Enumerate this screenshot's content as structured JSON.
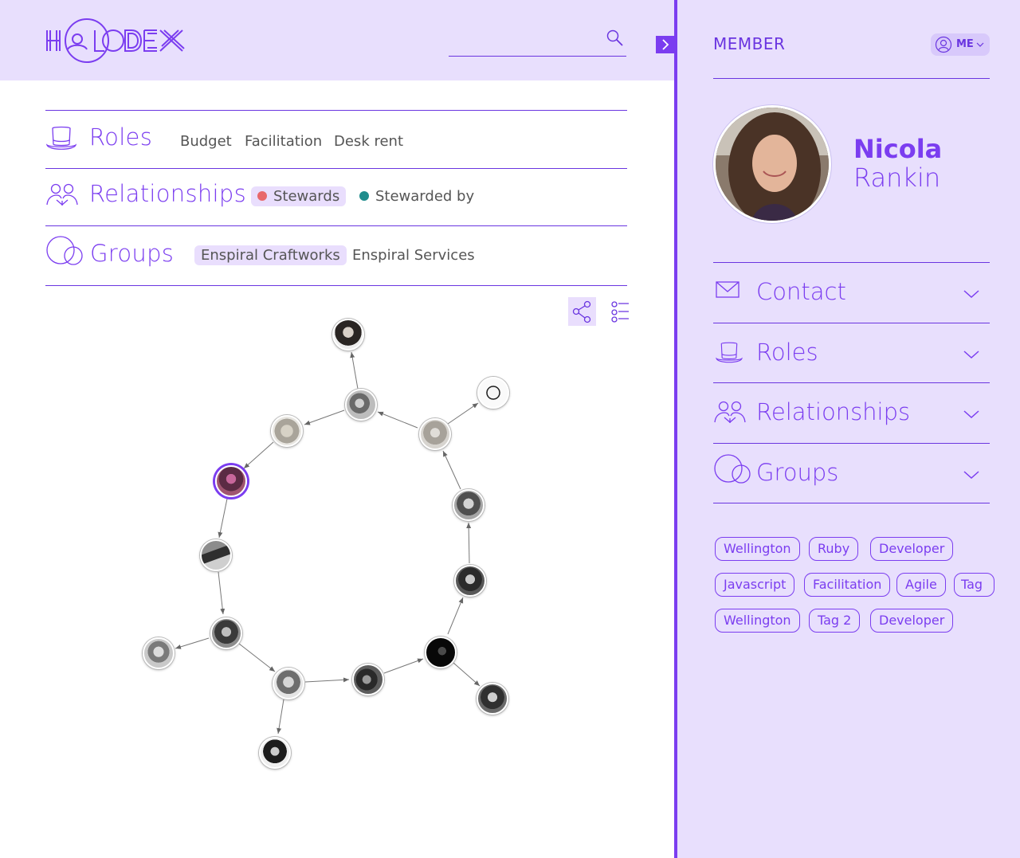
{
  "app": {
    "logo_text": "HOLODEX"
  },
  "search": {
    "placeholder": ""
  },
  "sections": {
    "roles": {
      "title": "Roles",
      "items": [
        "Budget",
        "Facilitation",
        "Desk rent"
      ]
    },
    "relationships": {
      "title": "Relationships",
      "items": [
        {
          "label": "Stewards",
          "color": "#e8686b",
          "active": true
        },
        {
          "label": "Stewarded by",
          "color": "#1f8c8c",
          "active": false
        }
      ]
    },
    "groups": {
      "title": "Groups",
      "items": [
        "Enspiral Craftworks",
        "Enspiral Services"
      ]
    }
  },
  "view_toggle": {
    "active": "graph",
    "options": [
      "graph-icon",
      "list-icon"
    ]
  },
  "colors": {
    "accent": "#7b3df0",
    "panel_bg": "#e8dffd",
    "stewards": "#e8686b",
    "stewarded_by": "#1f8c8c"
  },
  "panel": {
    "label": "MEMBER",
    "me_button": "ME",
    "first_name": "Nicola",
    "last_name": "Rankin",
    "accordions": [
      "Contact",
      "Roles",
      "Relationships",
      "Groups"
    ],
    "tags": [
      "Wellington",
      "Ruby",
      "Developer",
      "Javascript",
      "Facilitation",
      "Agile",
      "Tag",
      "Wellington",
      "Tag 2",
      "Developer"
    ]
  }
}
